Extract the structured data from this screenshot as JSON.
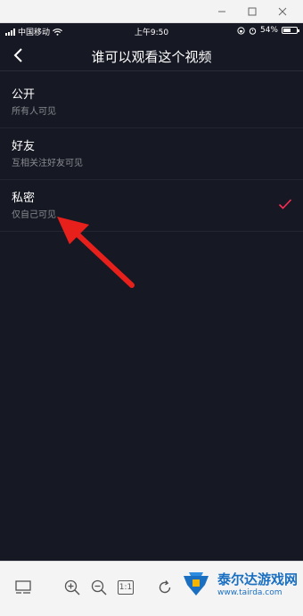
{
  "status_bar": {
    "carrier": "中国移动",
    "time": "上午9:50",
    "battery": "54%",
    "battery_level": 0.54
  },
  "nav": {
    "title": "谁可以观看这个视频"
  },
  "options": [
    {
      "title": "公开",
      "desc": "所有人可见",
      "selected": false
    },
    {
      "title": "好友",
      "desc": "互相关注好友可见",
      "selected": false
    },
    {
      "title": "私密",
      "desc": "仅自己可见",
      "selected": true
    }
  ],
  "toolbar": {
    "one_to_one_label": "1:1"
  },
  "watermark": {
    "name": "泰尔达游戏网",
    "url": "www.tairda.com"
  },
  "colors": {
    "background": "#161823",
    "check": "#fe2c55",
    "annotation_arrow": "#e8201c",
    "watermark_blue": "#1a6fc0"
  }
}
